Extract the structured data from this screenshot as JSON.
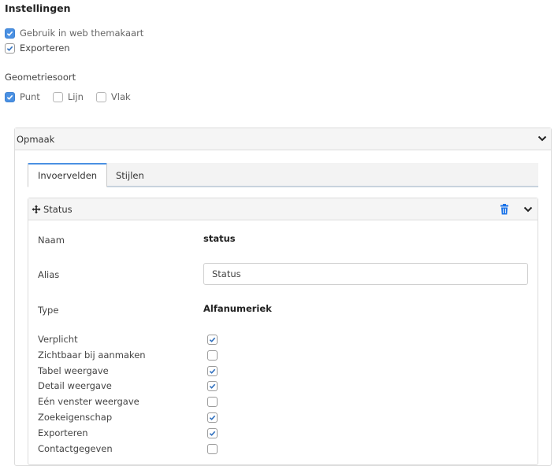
{
  "title": "Instellingen",
  "options": [
    {
      "label": "Gebruik in web themakaart",
      "checked": true
    },
    {
      "label": "Exporteren",
      "checked": true
    }
  ],
  "geometry": {
    "label": "Geometriesoort",
    "items": [
      {
        "label": "Punt",
        "checked": true
      },
      {
        "label": "Lijn",
        "checked": false
      },
      {
        "label": "Vlak",
        "checked": false
      }
    ]
  },
  "panel": {
    "title": "Opmaak",
    "chevron": "chevron-down-icon",
    "tabs": [
      {
        "label": "Invoervelden",
        "active": true
      },
      {
        "label": "Stijlen",
        "active": false
      }
    ],
    "field": {
      "title": "Status",
      "move_icon": "move-icon",
      "delete_icon": "trash-icon",
      "name_label": "Naam",
      "name_value": "status",
      "alias_label": "Alias",
      "alias_value": "Status",
      "type_label": "Type",
      "type_value": "Alfanumeriek",
      "flags": [
        {
          "label": "Verplicht",
          "checked": true
        },
        {
          "label": "Zichtbaar bij aanmaken",
          "checked": false
        },
        {
          "label": "Tabel weergave",
          "checked": true
        },
        {
          "label": "Detail weergave",
          "checked": true
        },
        {
          "label": "Eén venster weergave",
          "checked": false
        },
        {
          "label": "Zoekeigenschap",
          "checked": true
        },
        {
          "label": "Exporteren",
          "checked": true
        },
        {
          "label": "Contactgegeven",
          "checked": false
        }
      ]
    }
  },
  "colors": {
    "accent": "#4a90e2",
    "trash": "#1a73e8"
  }
}
